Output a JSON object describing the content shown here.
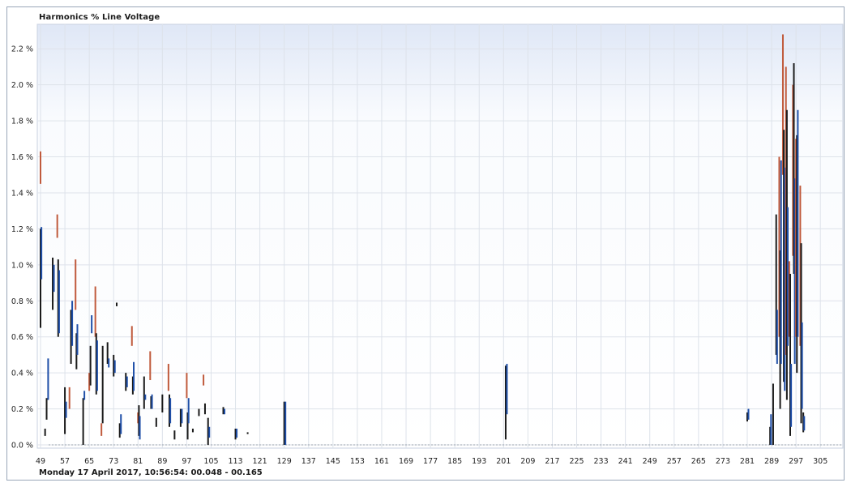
{
  "chart_data": {
    "type": "bar",
    "title": "Harmonics % Line Voltage",
    "footer": "Monday 17 April 2017, 10:56:54: 00.048 - 00.165",
    "ylim": [
      0.0,
      2.3
    ],
    "xlim": [
      49,
      310
    ],
    "grid": true,
    "y_ticks": [
      "0.0 %",
      "0.2 %",
      "0.4 %",
      "0.6 %",
      "0.8 %",
      "1.0 %",
      "1.2 %",
      "1.4 %",
      "1.6 %",
      "1.8 %",
      "2.0 %",
      "2.2 %"
    ],
    "y_tick_values": [
      0.0,
      0.2,
      0.4,
      0.6,
      0.8,
      1.0,
      1.2,
      1.4,
      1.6,
      1.8,
      2.0,
      2.2
    ],
    "x_ticks": [
      "49",
      "57",
      "65",
      "73",
      "81",
      "89",
      "97",
      "105",
      "113",
      "121",
      "129",
      "137",
      "145",
      "153",
      "161",
      "169",
      "177",
      "185",
      "193",
      "201",
      "209",
      "217",
      "225",
      "233",
      "241",
      "249",
      "257",
      "265",
      "273",
      "281",
      "289",
      "297",
      "305"
    ],
    "series_colors": [
      "#c05a3c",
      "#1a1a1a",
      "#1f4fa8"
    ],
    "bars": [
      {
        "x": 49,
        "color": "#c05a3c",
        "low": 1.45,
        "high": 1.63
      },
      {
        "x": 49,
        "color": "#1a1a1a",
        "low": 0.65,
        "high": 1.2
      },
      {
        "x": 49.3,
        "color": "#1f4fa8",
        "low": 0.92,
        "high": 1.21
      },
      {
        "x": 50.5,
        "color": "#1a1a1a",
        "low": 0.05,
        "high": 0.09
      },
      {
        "x": 51,
        "color": "#1a1a1a",
        "low": 0.14,
        "high": 0.26
      },
      {
        "x": 51.5,
        "color": "#1f4fa8",
        "low": 0.25,
        "high": 0.48
      },
      {
        "x": 53,
        "color": "#1a1a1a",
        "low": 0.75,
        "high": 1.04
      },
      {
        "x": 53.4,
        "color": "#1f4fa8",
        "low": 0.85,
        "high": 1.0
      },
      {
        "x": 54.5,
        "color": "#c05a3c",
        "low": 1.15,
        "high": 1.28
      },
      {
        "x": 54.8,
        "color": "#1a1a1a",
        "low": 0.6,
        "high": 1.03
      },
      {
        "x": 55.1,
        "color": "#1f4fa8",
        "low": 0.62,
        "high": 0.97
      },
      {
        "x": 57,
        "color": "#1a1a1a",
        "low": 0.06,
        "high": 0.32
      },
      {
        "x": 57.4,
        "color": "#1f4fa8",
        "low": 0.15,
        "high": 0.24
      },
      {
        "x": 58.5,
        "color": "#c05a3c",
        "low": 0.2,
        "high": 0.32
      },
      {
        "x": 59,
        "color": "#1a1a1a",
        "low": 0.45,
        "high": 0.75
      },
      {
        "x": 59.4,
        "color": "#1f4fa8",
        "low": 0.55,
        "high": 0.8
      },
      {
        "x": 60.5,
        "color": "#c05a3c",
        "low": 0.75,
        "high": 1.03
      },
      {
        "x": 60.8,
        "color": "#1a1a1a",
        "low": 0.42,
        "high": 0.62
      },
      {
        "x": 61.1,
        "color": "#1f4fa8",
        "low": 0.5,
        "high": 0.67
      },
      {
        "x": 63,
        "color": "#1a1a1a",
        "low": 0.0,
        "high": 0.26
      },
      {
        "x": 63.4,
        "color": "#1f4fa8",
        "low": 0.25,
        "high": 0.3
      },
      {
        "x": 65,
        "color": "#c05a3c",
        "low": 0.3,
        "high": 0.4
      },
      {
        "x": 65.4,
        "color": "#1a1a1a",
        "low": 0.33,
        "high": 0.55
      },
      {
        "x": 65.8,
        "color": "#1f4fa8",
        "low": 0.62,
        "high": 0.72
      },
      {
        "x": 67,
        "color": "#c05a3c",
        "low": 0.6,
        "high": 0.88
      },
      {
        "x": 67.3,
        "color": "#1a1a1a",
        "low": 0.28,
        "high": 0.62
      },
      {
        "x": 67.6,
        "color": "#1f4fa8",
        "low": 0.3,
        "high": 0.58
      },
      {
        "x": 69,
        "color": "#c05a3c",
        "low": 0.05,
        "high": 0.12
      },
      {
        "x": 69.4,
        "color": "#1a1a1a",
        "low": 0.12,
        "high": 0.55
      },
      {
        "x": 71,
        "color": "#1a1a1a",
        "low": 0.45,
        "high": 0.57
      },
      {
        "x": 71.4,
        "color": "#1f4fa8",
        "low": 0.43,
        "high": 0.48
      },
      {
        "x": 73,
        "color": "#1a1a1a",
        "low": 0.38,
        "high": 0.5
      },
      {
        "x": 73.4,
        "color": "#1f4fa8",
        "low": 0.4,
        "high": 0.47
      },
      {
        "x": 74,
        "color": "#1a1a1a",
        "low": 0.77,
        "high": 0.79
      },
      {
        "x": 75,
        "color": "#1a1a1a",
        "low": 0.04,
        "high": 0.12
      },
      {
        "x": 75.4,
        "color": "#1f4fa8",
        "low": 0.06,
        "high": 0.17
      },
      {
        "x": 77,
        "color": "#1a1a1a",
        "low": 0.3,
        "high": 0.4
      },
      {
        "x": 77.4,
        "color": "#1f4fa8",
        "low": 0.32,
        "high": 0.38
      },
      {
        "x": 79,
        "color": "#c05a3c",
        "low": 0.55,
        "high": 0.66
      },
      {
        "x": 79.3,
        "color": "#1a1a1a",
        "low": 0.28,
        "high": 0.38
      },
      {
        "x": 79.6,
        "color": "#1f4fa8",
        "low": 0.3,
        "high": 0.46
      },
      {
        "x": 81,
        "color": "#c05a3c",
        "low": 0.12,
        "high": 0.18
      },
      {
        "x": 81.3,
        "color": "#1a1a1a",
        "low": 0.05,
        "high": 0.22
      },
      {
        "x": 81.6,
        "color": "#1f4fa8",
        "low": 0.03,
        "high": 0.16
      },
      {
        "x": 83,
        "color": "#1a1a1a",
        "low": 0.2,
        "high": 0.38
      },
      {
        "x": 83.4,
        "color": "#1f4fa8",
        "low": 0.25,
        "high": 0.28
      },
      {
        "x": 85,
        "color": "#c05a3c",
        "low": 0.36,
        "high": 0.52
      },
      {
        "x": 85.3,
        "color": "#1a1a1a",
        "low": 0.2,
        "high": 0.27
      },
      {
        "x": 85.6,
        "color": "#1f4fa8",
        "low": 0.2,
        "high": 0.28
      },
      {
        "x": 87,
        "color": "#1a1a1a",
        "low": 0.1,
        "high": 0.15
      },
      {
        "x": 89,
        "color": "#1a1a1a",
        "low": 0.18,
        "high": 0.28
      },
      {
        "x": 91,
        "color": "#c05a3c",
        "low": 0.3,
        "high": 0.45
      },
      {
        "x": 91.3,
        "color": "#1a1a1a",
        "low": 0.1,
        "high": 0.28
      },
      {
        "x": 91.6,
        "color": "#1f4fa8",
        "low": 0.12,
        "high": 0.26
      },
      {
        "x": 93,
        "color": "#1a1a1a",
        "low": 0.03,
        "high": 0.08
      },
      {
        "x": 95,
        "color": "#1a1a1a",
        "low": 0.1,
        "high": 0.2
      },
      {
        "x": 95.4,
        "color": "#1f4fa8",
        "low": 0.12,
        "high": 0.2
      },
      {
        "x": 97,
        "color": "#c05a3c",
        "low": 0.26,
        "high": 0.4
      },
      {
        "x": 97.3,
        "color": "#1a1a1a",
        "low": 0.03,
        "high": 0.18
      },
      {
        "x": 97.6,
        "color": "#1f4fa8",
        "low": 0.12,
        "high": 0.26
      },
      {
        "x": 99,
        "color": "#1a1a1a",
        "low": 0.07,
        "high": 0.09
      },
      {
        "x": 101,
        "color": "#1a1a1a",
        "low": 0.16,
        "high": 0.2
      },
      {
        "x": 102.5,
        "color": "#c05a3c",
        "low": 0.33,
        "high": 0.39
      },
      {
        "x": 103,
        "color": "#1a1a1a",
        "low": 0.17,
        "high": 0.23
      },
      {
        "x": 104,
        "color": "#1a1a1a",
        "low": 0.0,
        "high": 0.15
      },
      {
        "x": 104.4,
        "color": "#1f4fa8",
        "low": 0.04,
        "high": 0.1
      },
      {
        "x": 109,
        "color": "#1a1a1a",
        "low": 0.17,
        "high": 0.21
      },
      {
        "x": 109.4,
        "color": "#1f4fa8",
        "low": 0.17,
        "high": 0.2
      },
      {
        "x": 113,
        "color": "#1a1a1a",
        "low": 0.03,
        "high": 0.09
      },
      {
        "x": 113.4,
        "color": "#1f4fa8",
        "low": 0.04,
        "high": 0.09
      },
      {
        "x": 117,
        "color": "#1a1a1a",
        "low": 0.06,
        "high": 0.07
      },
      {
        "x": 129,
        "color": "#1a1a1a",
        "low": 0.0,
        "high": 0.24
      },
      {
        "x": 129.4,
        "color": "#1f4fa8",
        "low": 0.0,
        "high": 0.24
      },
      {
        "x": 201.7,
        "color": "#1a1a1a",
        "low": 0.03,
        "high": 0.44
      },
      {
        "x": 202.1,
        "color": "#1f4fa8",
        "low": 0.17,
        "high": 0.45
      },
      {
        "x": 281,
        "color": "#1a1a1a",
        "low": 0.13,
        "high": 0.18
      },
      {
        "x": 281.4,
        "color": "#1f4fa8",
        "low": 0.14,
        "high": 0.2
      },
      {
        "x": 288.5,
        "color": "#1a1a1a",
        "low": 0.0,
        "high": 0.1
      },
      {
        "x": 288.8,
        "color": "#1f4fa8",
        "low": 0.0,
        "high": 0.17
      },
      {
        "x": 289.5,
        "color": "#1a1a1a",
        "low": 0.0,
        "high": 0.34
      },
      {
        "x": 290.5,
        "color": "#1a1a1a",
        "low": 0.5,
        "high": 1.28
      },
      {
        "x": 290.8,
        "color": "#1f4fa8",
        "low": 0.45,
        "high": 0.75
      },
      {
        "x": 291.5,
        "color": "#c05a3c",
        "low": 0.6,
        "high": 1.6
      },
      {
        "x": 291.8,
        "color": "#1a1a1a",
        "low": 0.2,
        "high": 1.08
      },
      {
        "x": 292.1,
        "color": "#1f4fa8",
        "low": 0.45,
        "high": 1.58
      },
      {
        "x": 292.7,
        "color": "#c05a3c",
        "low": 1.5,
        "high": 2.28
      },
      {
        "x": 293,
        "color": "#1a1a1a",
        "low": 0.35,
        "high": 1.75
      },
      {
        "x": 293.3,
        "color": "#1f4fa8",
        "low": 0.3,
        "high": 1.54
      },
      {
        "x": 293.7,
        "color": "#c05a3c",
        "low": 0.5,
        "high": 2.1
      },
      {
        "x": 294,
        "color": "#1a1a1a",
        "low": 0.25,
        "high": 1.86
      },
      {
        "x": 294.3,
        "color": "#1f4fa8",
        "low": 0.55,
        "high": 1.32
      },
      {
        "x": 294.8,
        "color": "#c05a3c",
        "low": 0.6,
        "high": 1.02
      },
      {
        "x": 295.1,
        "color": "#1a1a1a",
        "low": 0.05,
        "high": 0.95
      },
      {
        "x": 295.4,
        "color": "#1f4fa8",
        "low": 0.1,
        "high": 0.45
      },
      {
        "x": 296,
        "color": "#c05a3c",
        "low": 1.05,
        "high": 2.0
      },
      {
        "x": 296.3,
        "color": "#1a1a1a",
        "low": 0.95,
        "high": 2.12
      },
      {
        "x": 296.6,
        "color": "#1f4fa8",
        "low": 0.45,
        "high": 1.48
      },
      {
        "x": 297,
        "color": "#c05a3c",
        "low": 0.6,
        "high": 1.7
      },
      {
        "x": 297.3,
        "color": "#1a1a1a",
        "low": 0.4,
        "high": 1.72
      },
      {
        "x": 297.6,
        "color": "#1f4fa8",
        "low": 0.6,
        "high": 1.86
      },
      {
        "x": 298.4,
        "color": "#c05a3c",
        "low": 0.55,
        "high": 1.44
      },
      {
        "x": 298.7,
        "color": "#1a1a1a",
        "low": 0.12,
        "high": 1.12
      },
      {
        "x": 299,
        "color": "#1f4fa8",
        "low": 0.2,
        "high": 0.68
      },
      {
        "x": 299.4,
        "color": "#1a1a1a",
        "low": 0.07,
        "high": 0.18
      },
      {
        "x": 299.7,
        "color": "#1f4fa8",
        "low": 0.08,
        "high": 0.16
      }
    ]
  }
}
